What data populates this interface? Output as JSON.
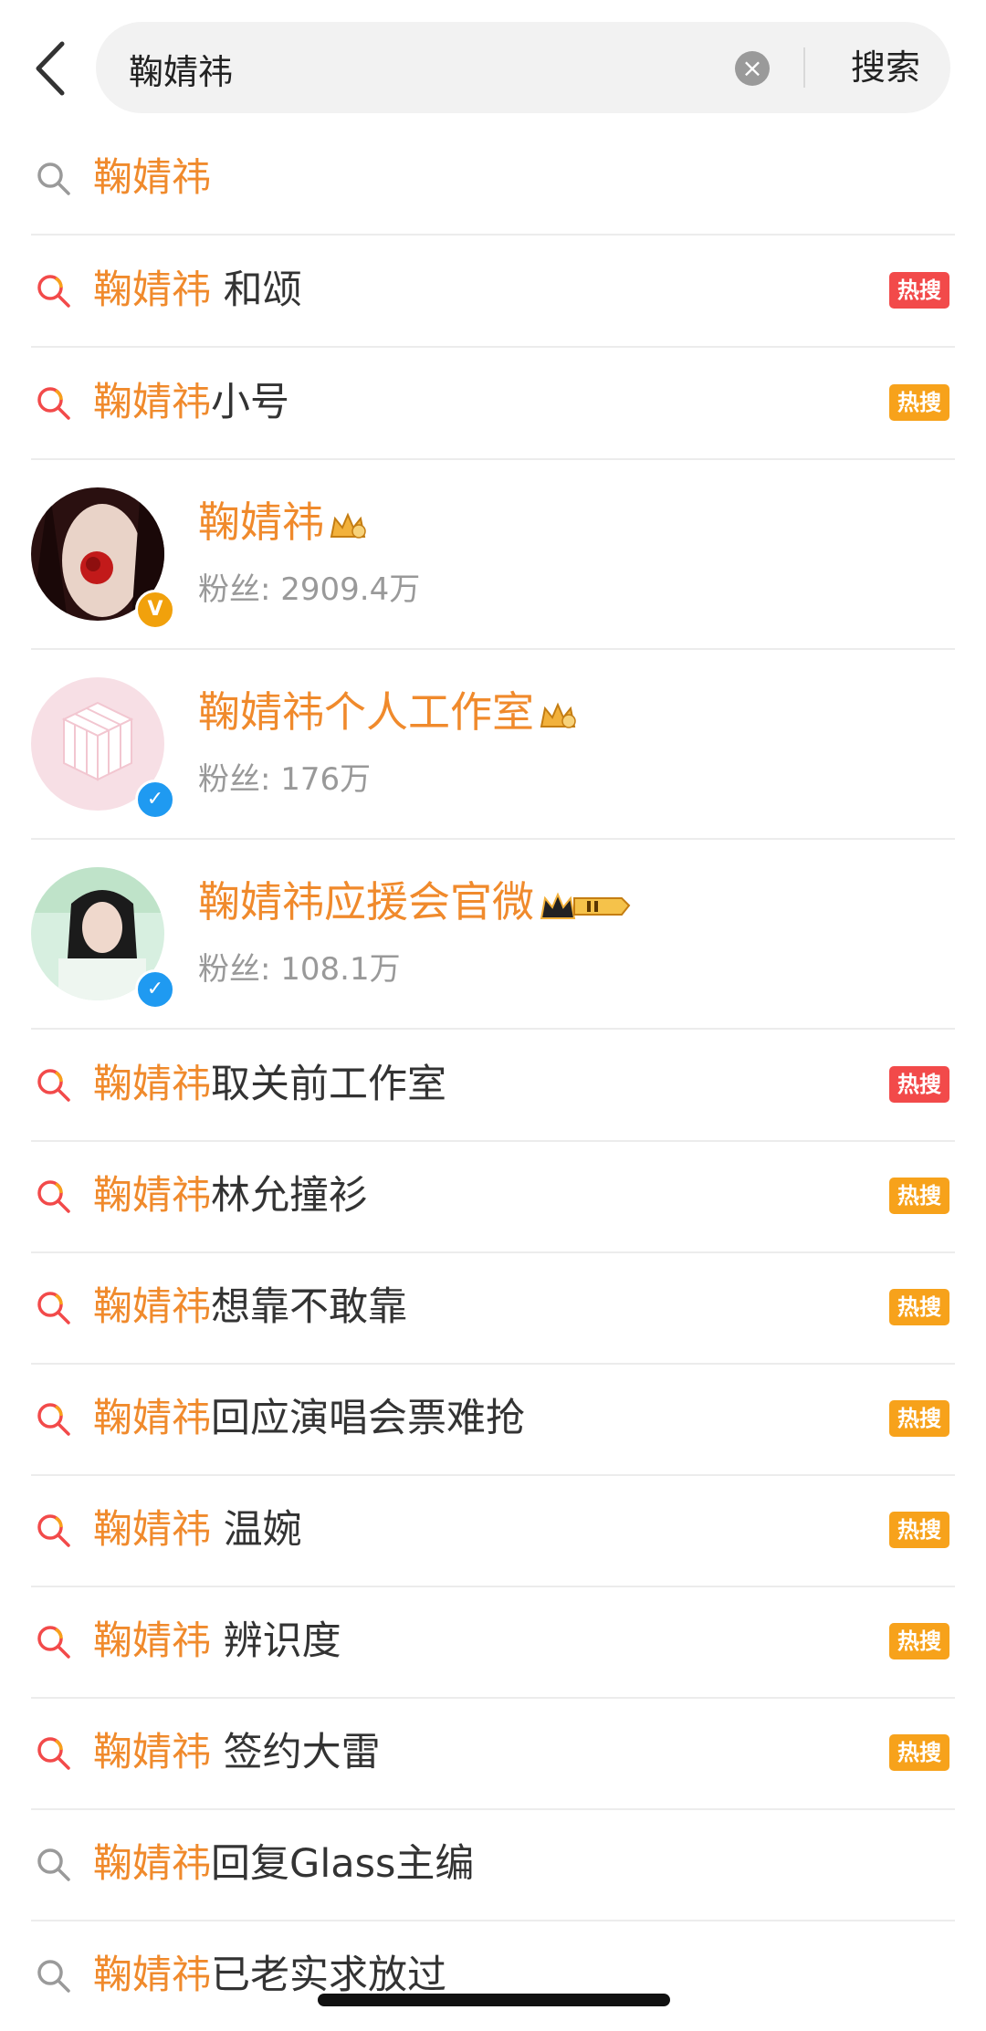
{
  "search": {
    "query": "鞠婧祎",
    "button_label": "搜索"
  },
  "colors": {
    "highlight": "#f08a2c",
    "hot_red": "#f24a4a",
    "hot_orange": "#f7a21b"
  },
  "suggestions_top": [
    {
      "hl": "鞠婧祎",
      "rest": "",
      "icon": "search-icon",
      "badge": ""
    },
    {
      "hl": "鞠婧祎",
      "rest": " 和颂",
      "icon": "hot-search-icon",
      "badge": "热搜",
      "badge_color": "red"
    },
    {
      "hl": "鞠婧祎",
      "rest": "小号",
      "icon": "hot-search-icon",
      "badge": "热搜",
      "badge_color": "orange"
    }
  ],
  "users": [
    {
      "name": "鞠婧祎",
      "fans": "粉丝: 2909.4万",
      "verify": "gold",
      "verify_icon": "V"
    },
    {
      "name": "鞠婧祎个人工作室",
      "fans": "粉丝: 176万",
      "verify": "blue",
      "verify_icon": "✓"
    },
    {
      "name": "鞠婧祎应援会官微",
      "fans": "粉丝: 108.1万",
      "verify": "blue",
      "verify_icon": "✓"
    }
  ],
  "suggestions_bottom": [
    {
      "hl": "鞠婧祎",
      "rest": "取关前工作室",
      "icon": "hot-search-icon",
      "badge": "热搜",
      "badge_color": "red"
    },
    {
      "hl": "鞠婧祎",
      "rest": "林允撞衫",
      "icon": "hot-search-icon",
      "badge": "热搜",
      "badge_color": "orange"
    },
    {
      "hl": "鞠婧祎",
      "rest": "想靠不敢靠",
      "icon": "hot-search-icon",
      "badge": "热搜",
      "badge_color": "orange"
    },
    {
      "hl": "鞠婧祎",
      "rest": "回应演唱会票难抢",
      "icon": "hot-search-icon",
      "badge": "热搜",
      "badge_color": "orange"
    },
    {
      "hl": "鞠婧祎",
      "rest": " 温婉",
      "icon": "hot-search-icon",
      "badge": "热搜",
      "badge_color": "orange"
    },
    {
      "hl": "鞠婧祎",
      "rest": " 辨识度",
      "icon": "hot-search-icon",
      "badge": "热搜",
      "badge_color": "orange"
    },
    {
      "hl": "鞠婧祎",
      "rest": " 签约大雷",
      "icon": "hot-search-icon",
      "badge": "热搜",
      "badge_color": "orange"
    },
    {
      "hl": "鞠婧祎",
      "rest": "回复Glass主编",
      "icon": "search-icon",
      "badge": ""
    },
    {
      "hl": "鞠婧祎",
      "rest": "已老实求放过",
      "icon": "search-icon",
      "badge": ""
    }
  ]
}
